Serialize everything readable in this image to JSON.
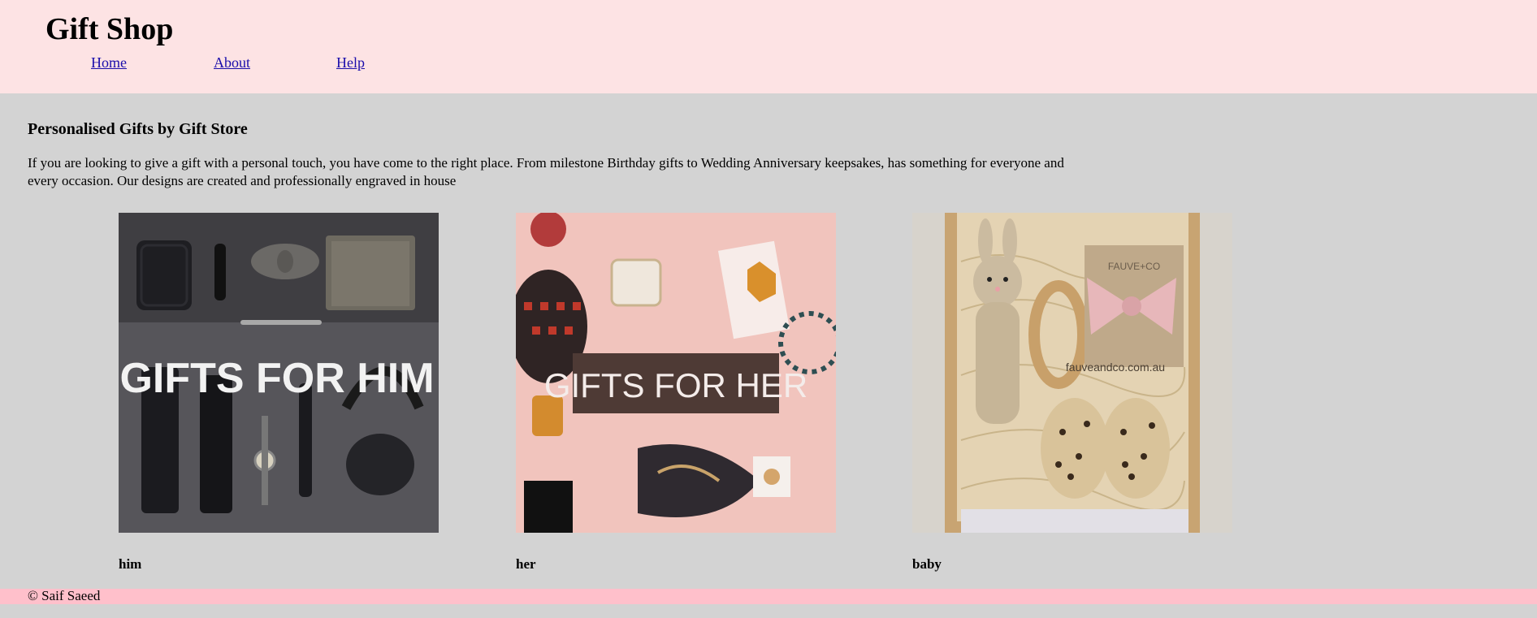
{
  "header": {
    "title": "Gift Shop",
    "nav": [
      {
        "label": "Home"
      },
      {
        "label": "About"
      },
      {
        "label": "Help"
      }
    ]
  },
  "main": {
    "title": "Personalised Gifts by Gift Store",
    "intro": "If you are looking to give a gift with a personal touch, you have come to the right place. From milestone Birthday gifts to Wedding Anniversary keepsakes, has something for everyone and every occasion. Our designs are created and professionally engraved in house",
    "cards": [
      {
        "label": "him",
        "banner": "GIFTS FOR HIM"
      },
      {
        "label": "her",
        "banner": "GIFTS FOR HER"
      },
      {
        "label": "baby",
        "brand": "FAUVE+CO",
        "url_text": "fauveandco.com.au"
      }
    ]
  },
  "footer": {
    "text": "© Saif Saeed"
  },
  "colors": {
    "header_bg": "#fde3e4",
    "page_bg": "#d3d3d3",
    "footer_bg": "#ffc0cb",
    "link": "#1a0dab"
  }
}
